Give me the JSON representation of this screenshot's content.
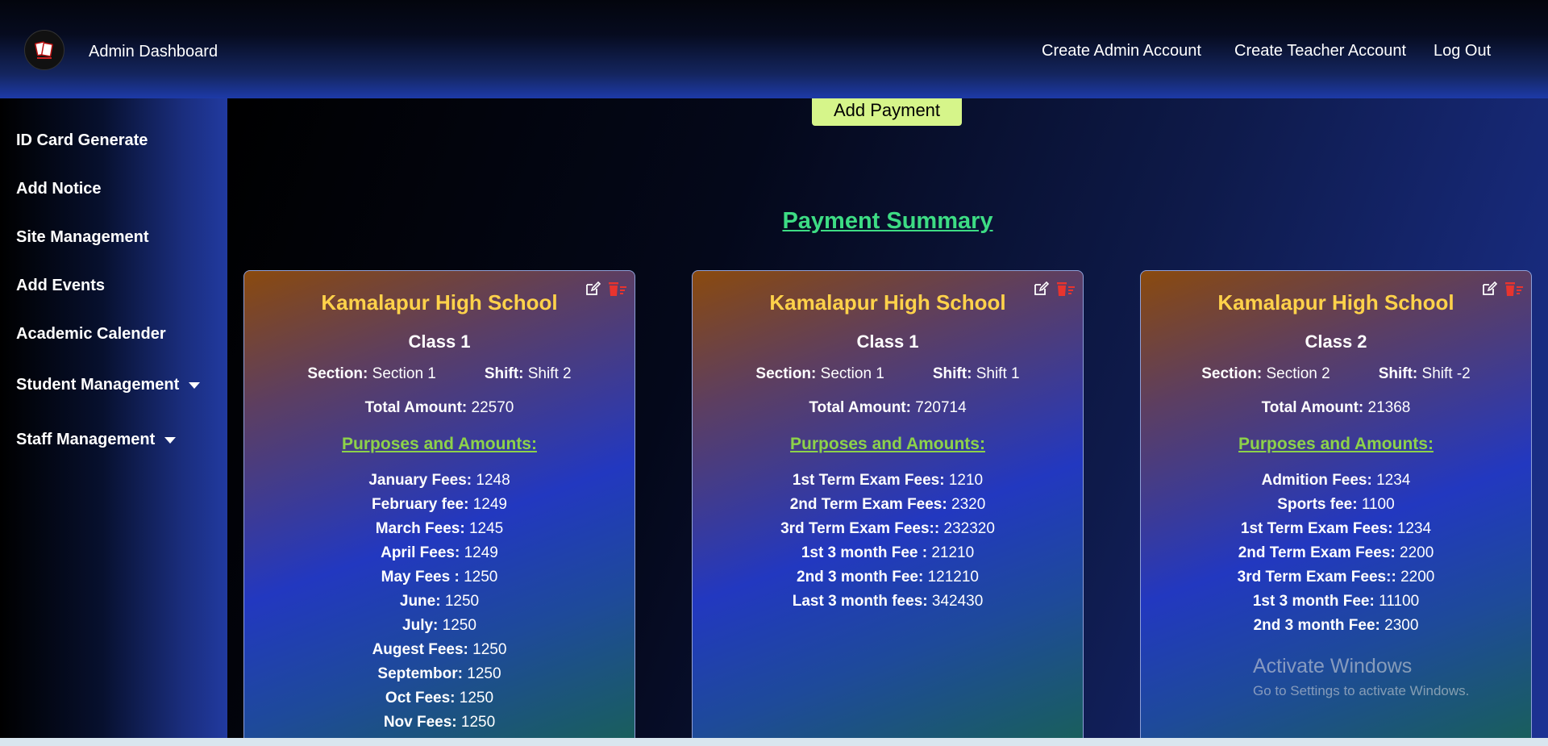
{
  "header": {
    "app_title": "Admin Dashboard",
    "nav": [
      "Create Admin Account",
      "Create Teacher Account",
      "Log Out"
    ]
  },
  "sidebar": {
    "items": [
      {
        "label": "ID Card Generate"
      },
      {
        "label": "Add Notice"
      },
      {
        "label": "Site Management"
      },
      {
        "label": "Add Events"
      },
      {
        "label": "Academic Calender"
      },
      {
        "label": "Student Management",
        "dropdown": true
      },
      {
        "label": "Staff Management",
        "dropdown": true
      }
    ]
  },
  "main": {
    "add_payment_label": "Add Payment",
    "summary_title": "Payment Summary",
    "section_label": "Section:",
    "shift_label": "Shift:",
    "total_label": "Total Amount:",
    "purposes_label": "Purposes and Amounts:",
    "cards": [
      {
        "school": "Kamalapur High School",
        "class": "Class 1",
        "section": "Section 1",
        "shift": "Shift 2",
        "total": "22570",
        "items": [
          {
            "k": "January Fees:",
            "v": "1248"
          },
          {
            "k": "February fee:",
            "v": "1249"
          },
          {
            "k": "March Fees:",
            "v": "1245"
          },
          {
            "k": "April Fees:",
            "v": "1249"
          },
          {
            "k": "May Fees :",
            "v": "1250"
          },
          {
            "k": "June:",
            "v": "1250"
          },
          {
            "k": "July:",
            "v": "1250"
          },
          {
            "k": "Augest Fees:",
            "v": "1250"
          },
          {
            "k": "Septembor:",
            "v": "1250"
          },
          {
            "k": "Oct Fees:",
            "v": "1250"
          },
          {
            "k": "Nov Fees:",
            "v": "1250"
          }
        ]
      },
      {
        "school": "Kamalapur High School",
        "class": "Class 1",
        "section": "Section 1",
        "shift": "Shift 1",
        "total": "720714",
        "items": [
          {
            "k": "1st Term Exam Fees:",
            "v": "1210"
          },
          {
            "k": "2nd Term Exam Fees:",
            "v": "2320"
          },
          {
            "k": "3rd Term Exam Fees::",
            "v": "232320"
          },
          {
            "k": "1st 3 month Fee :",
            "v": "21210"
          },
          {
            "k": "2nd 3 month Fee:",
            "v": "121210"
          },
          {
            "k": "Last 3 month fees:",
            "v": "342430"
          }
        ]
      },
      {
        "school": "Kamalapur High School",
        "class": "Class 2",
        "section": "Section 2",
        "shift": "Shift -2",
        "total": "21368",
        "items": [
          {
            "k": "Admition Fees:",
            "v": "1234"
          },
          {
            "k": "Sports fee:",
            "v": "1100"
          },
          {
            "k": "1st Term Exam Fees:",
            "v": "1234"
          },
          {
            "k": "2nd Term Exam Fees:",
            "v": "2200"
          },
          {
            "k": "3rd Term Exam Fees::",
            "v": "2200"
          },
          {
            "k": "1st 3 month Fee:",
            "v": "11100"
          },
          {
            "k": "2nd 3 month Fee:",
            "v": "2300"
          }
        ]
      }
    ]
  },
  "watermark": {
    "line1": "Activate Windows",
    "line2": "Go to Settings to activate Windows."
  },
  "colors": {
    "school_title": "#ffd24a",
    "summary_title": "#3ddc84",
    "purposes": "#8dd24a",
    "add_payment_bg": "#d6f58a",
    "delete_icon": "#e8342e"
  },
  "icons": [
    "app-logo-icon",
    "edit-icon",
    "delete-icon",
    "chevron-down-icon"
  ]
}
